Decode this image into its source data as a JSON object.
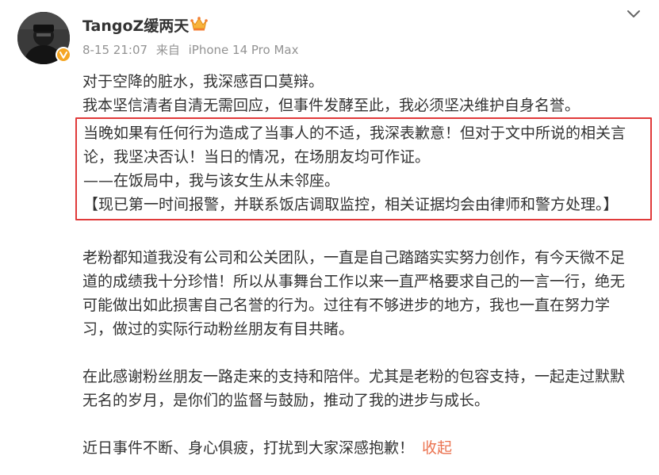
{
  "post": {
    "author": {
      "name": "TangoZ缓两天",
      "avatar_icon": "avatar-image",
      "badge_icon": "verified-badge-icon",
      "crown_icon": "vip-crown-icon"
    },
    "meta": {
      "time": "8-15 21:07",
      "source_prefix": "来自",
      "device": "iPhone 14 Pro Max"
    },
    "menu_icon": "chevron-down-icon",
    "lines": {
      "l1": "对于空降的脏水，我深感百口莫辩。",
      "l2": "我本坚信清者自清无需回应，但事件发酵至此，我必须坚决维护自身名誉。"
    },
    "highlight": {
      "h1": "当晚如果有任何行为造成了当事人的不适，我深表歉意！但对于文中所说的相关言",
      "h2": "论，我坚决否认！当日的情况，在场朋友均可作证。",
      "h3": "——在饭局中，我与该女生从未邻座。",
      "h4": "【现已第一时间报警，并联系饭店调取监控，相关证据均会由律师和警方处理。】"
    },
    "para1": {
      "p1": "老粉都知道我没有公司和公关团队，一直是自己踏踏实实努力创作，有今天微不足",
      "p2": "道的成绩我十分珍惜！所以从事舞台工作以来一直严格要求自己的一言一行，绝无",
      "p3": "可能做出如此损害自己名誉的行为。过往有不够进步的地方，我也一直在努力学",
      "p4": "习，做过的实际行动粉丝朋友有目共睹。"
    },
    "para2": {
      "p1": "在此感谢粉丝朋友一路走来的支持和陪伴。尤其是老粉的包容支持，一起走过默默",
      "p2": "无名的岁月，是你们的监督与鼓励，推动了我的进步与成长。"
    },
    "para3": {
      "p1": "近日事件不断、身心俱疲，打扰到大家深感抱歉！",
      "collapse": "收起"
    },
    "colors": {
      "highlight_border": "#e03a3a",
      "link": "#eb7350",
      "meta_text": "#939393",
      "badge": "#f5a623"
    }
  }
}
